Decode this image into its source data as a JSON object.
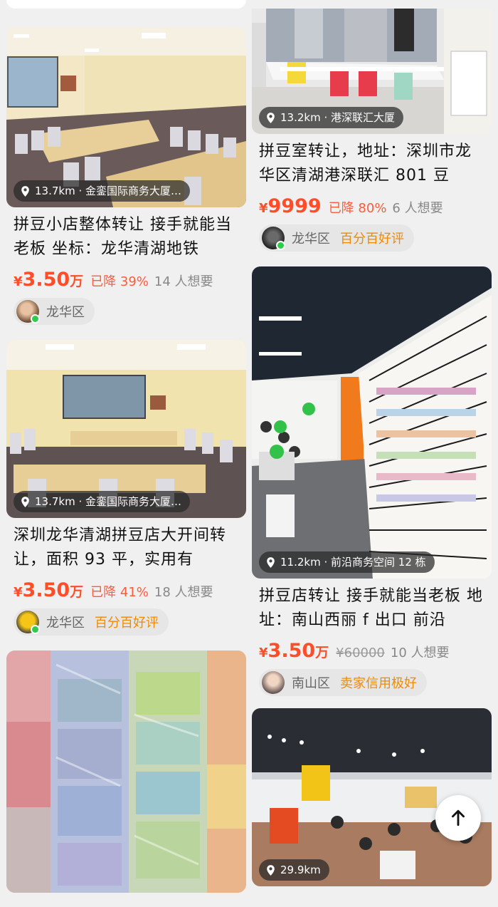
{
  "left": [
    {
      "title": "拼豆小店整体转让 接手就能当老板 坐标：龙华清湖地铁",
      "location": "13.7km · 金銮国际商务大厦…",
      "price_yen": "¥",
      "price": "3.50",
      "price_unit": "万",
      "drop": "已降 39%",
      "wants": "14 人想要",
      "region": "龙华区",
      "reputation": ""
    },
    {
      "title": "深圳龙华清湖拼豆店大开间转让，面积 93 平，实用有",
      "location": "13.7km · 金銮国际商务大厦…",
      "price_yen": "¥",
      "price": "3.50",
      "price_unit": "万",
      "drop": "已降 41%",
      "wants": "18 人想要",
      "region": "龙华区",
      "reputation": "百分百好评"
    }
  ],
  "right": [
    {
      "title": "拼豆室转让，地址：深圳市龙华区清湖港深联汇 801 豆",
      "location": "13.2km · 港深联汇大厦",
      "price_yen": "¥",
      "price": "9999",
      "drop": "已降 80%",
      "wants": "6 人想要",
      "region": "龙华区",
      "reputation": "百分百好评"
    },
    {
      "title": "拼豆店转让 接手就能当老板 地址：南山西丽 f 出口 前沿",
      "location": "11.2km · 前沿商务空间 12 栋",
      "price_yen": "¥",
      "price": "3.50",
      "price_unit": "万",
      "original_price": "¥60000",
      "wants": "10 人想要",
      "region": "南山区",
      "reputation": "卖家信用极好"
    },
    {
      "location": "29.9km"
    }
  ],
  "colors": {
    "price": "#ff4d2a",
    "reputation": "#f08a00",
    "online": "#2ecc4a"
  },
  "icons": {
    "pin": "location-pin-icon",
    "top": "arrow-up-icon"
  }
}
